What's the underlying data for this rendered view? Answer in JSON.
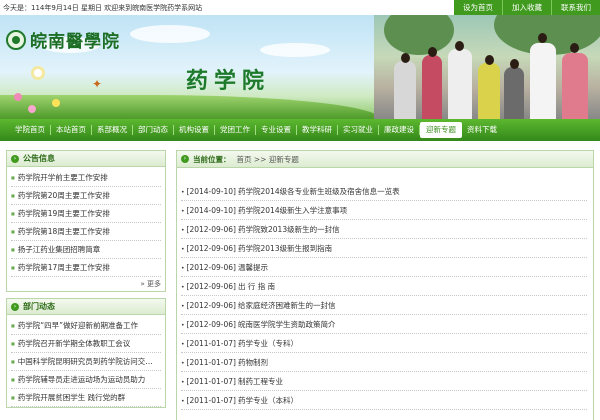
{
  "topbar": {
    "date_text": "今天是：114年9月14日  星期日   欢迎来到皖南医学院药学系网站",
    "links": [
      "设为首页",
      "加入收藏",
      "联系我们"
    ]
  },
  "banner": {
    "logo_text": "皖南醫學院",
    "title": "药学院"
  },
  "nav": {
    "items": [
      "学院首页",
      "本站首页",
      "系部概况",
      "部门动态",
      "机构设置",
      "党团工作",
      "专业设置",
      "教学科研",
      "实习就业",
      "廉政建设",
      "迎新专题",
      "资料下载"
    ],
    "active_index": 10
  },
  "sidebar": {
    "notices": {
      "title": "公告信息",
      "items": [
        "药学院开学前主要工作安排",
        "药学院第20周主要工作安排",
        "药学院第19周主要工作安排",
        "药学院第18周主要工作安排",
        "扬子江药业集团招聘简章",
        "药学院第17周主要工作安排"
      ],
      "more": "更多"
    },
    "news": {
      "title": "部门动态",
      "items": [
        "药学院“四早”做好迎新前期准备工作",
        "药学院召开新学期全体教职工会议",
        "中国科学院昆明研究员到药学院访问交…",
        "药学院辅导员走进运动场为运动员助力",
        "药学院开展贫困学生 践行党的群"
      ]
    }
  },
  "main": {
    "crumb_label": "当前位置：",
    "crumb_path": "首页 >> 迎新专题",
    "articles": [
      {
        "date": "[2014-09-10]",
        "title": "药学院2014级各专业新生班级及宿舍信息一览表"
      },
      {
        "date": "[2014-09-10]",
        "title": "药学院2014级新生入学注意事项"
      },
      {
        "date": "[2012-09-06]",
        "title": "药学院致2013级新生的一封信"
      },
      {
        "date": "[2012-09-06]",
        "title": "药学院2013级新生报到指南"
      },
      {
        "date": "[2012-09-06]",
        "title": "温馨提示"
      },
      {
        "date": "[2012-09-06]",
        "title": "出 行 指 南"
      },
      {
        "date": "[2012-09-06]",
        "title": "给家庭经济困难新生的一封信"
      },
      {
        "date": "[2012-09-06]",
        "title": "皖南医学院学生资助政策简介"
      },
      {
        "date": "[2011-01-07]",
        "title": "药学专业（专科）"
      },
      {
        "date": "[2011-01-07]",
        "title": "药物制剂"
      },
      {
        "date": "[2011-01-07]",
        "title": "制药工程专业"
      },
      {
        "date": "[2011-01-07]",
        "title": "药学专业（本科）"
      }
    ]
  }
}
